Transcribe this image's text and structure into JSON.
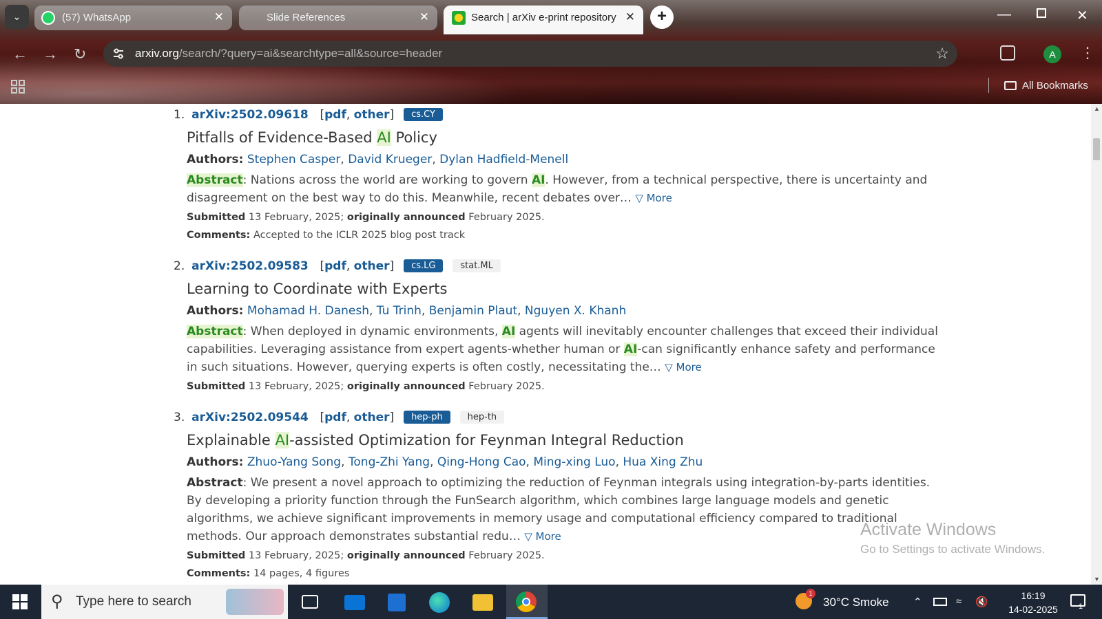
{
  "browser": {
    "tabs": [
      {
        "title": "(57) WhatsApp",
        "active": false
      },
      {
        "title": "Slide References",
        "active": false
      },
      {
        "title": "Search | arXiv e-print repository",
        "active": true
      }
    ],
    "close_glyph": "✕",
    "new_tab_glyph": "+",
    "url_host": "arxiv.org",
    "url_path": "/search/?query=ai&searchtype=all&source=header",
    "avatar_letter": "A",
    "bookmarks_label": "All Bookmarks"
  },
  "results": [
    {
      "num": "1.",
      "id": "arXiv:2502.09618",
      "pdf": "pdf",
      "other": "other",
      "primary_tag": "cs.CY",
      "secondary_tag": "",
      "title_pre": "Pitfalls of Evidence-Based ",
      "title_hl": "AI",
      "title_post": " Policy",
      "authors_label": "Authors:",
      "authors": [
        "Stephen Casper",
        "David Krueger",
        "Dylan Hadfield-Menell"
      ],
      "abstract_label": "Abstract",
      "abstract_lines": [
        [
          "Nations across the world are working to govern ",
          "AI",
          ". However, from a technical perspective, there is uncertainty and"
        ],
        [
          "disagreement on the best way to do this. Meanwhile, recent debates over…",
          "",
          ""
        ]
      ],
      "more": "▽ More",
      "submitted_label": "Submitted",
      "submitted": "13 February, 2025;",
      "announced_label": "originally announced",
      "announced": "February 2025.",
      "comments_label": "Comments:",
      "comments": "Accepted to the ICLR 2025 blog post track"
    },
    {
      "num": "2.",
      "id": "arXiv:2502.09583",
      "pdf": "pdf",
      "other": "other",
      "primary_tag": "cs.LG",
      "secondary_tag": "stat.ML",
      "title_pre": "Learning to Coordinate with Experts",
      "title_hl": "",
      "title_post": "",
      "authors_label": "Authors:",
      "authors": [
        "Mohamad H. Danesh",
        "Tu Trinh",
        "Benjamin Plaut",
        "Nguyen X. Khanh"
      ],
      "abstract_label": "Abstract",
      "abstract_lines": [
        [
          "When deployed in dynamic environments, ",
          "AI",
          " agents will inevitably encounter challenges that exceed their individual"
        ],
        [
          "capabilities. Leveraging assistance from expert agents-whether human or ",
          "AI",
          "-can significantly enhance safety and performance"
        ],
        [
          "in such situations. However, querying experts is often costly, necessitating the…",
          "",
          ""
        ]
      ],
      "more": "▽ More",
      "submitted_label": "Submitted",
      "submitted": "13 February, 2025;",
      "announced_label": "originally announced",
      "announced": "February 2025.",
      "comments_label": "",
      "comments": ""
    },
    {
      "num": "3.",
      "id": "arXiv:2502.09544",
      "pdf": "pdf",
      "other": "other",
      "primary_tag": "hep-ph",
      "secondary_tag": "hep-th",
      "title_pre": "Explainable ",
      "title_hl": "AI",
      "title_post": "-assisted Optimization for Feynman Integral Reduction",
      "authors_label": "Authors:",
      "authors": [
        "Zhuo-Yang Song",
        "Tong-Zhi Yang",
        "Qing-Hong Cao",
        "Ming-xing Luo",
        "Hua Xing Zhu"
      ],
      "abstract_label": "Abstract",
      "abstract_lines": [
        [
          "We present a novel approach to optimizing the reduction of Feynman integrals using integration-by-parts identities.",
          "",
          ""
        ],
        [
          "By developing a priority function through the FunSearch algorithm, which combines large language models and genetic",
          "",
          ""
        ],
        [
          "algorithms, we achieve significant improvements in memory usage and computational efficiency compared to traditional",
          "",
          ""
        ],
        [
          "methods. Our approach demonstrates substantial redu…",
          "",
          ""
        ]
      ],
      "more": "▽ More",
      "submitted_label": "Submitted",
      "submitted": "13 February, 2025;",
      "announced_label": "originally announced",
      "announced": "February 2025.",
      "comments_label": "Comments:",
      "comments": "14 pages, 4 figures"
    }
  ],
  "watermark": {
    "line1": "Activate Windows",
    "line2": "Go to Settings to activate Windows."
  },
  "taskbar": {
    "search_placeholder": "Type here to search",
    "weather": "30°C  Smoke",
    "weather_badge": "1",
    "time": "16:19",
    "date": "14-02-2025",
    "notif_count": "1"
  }
}
